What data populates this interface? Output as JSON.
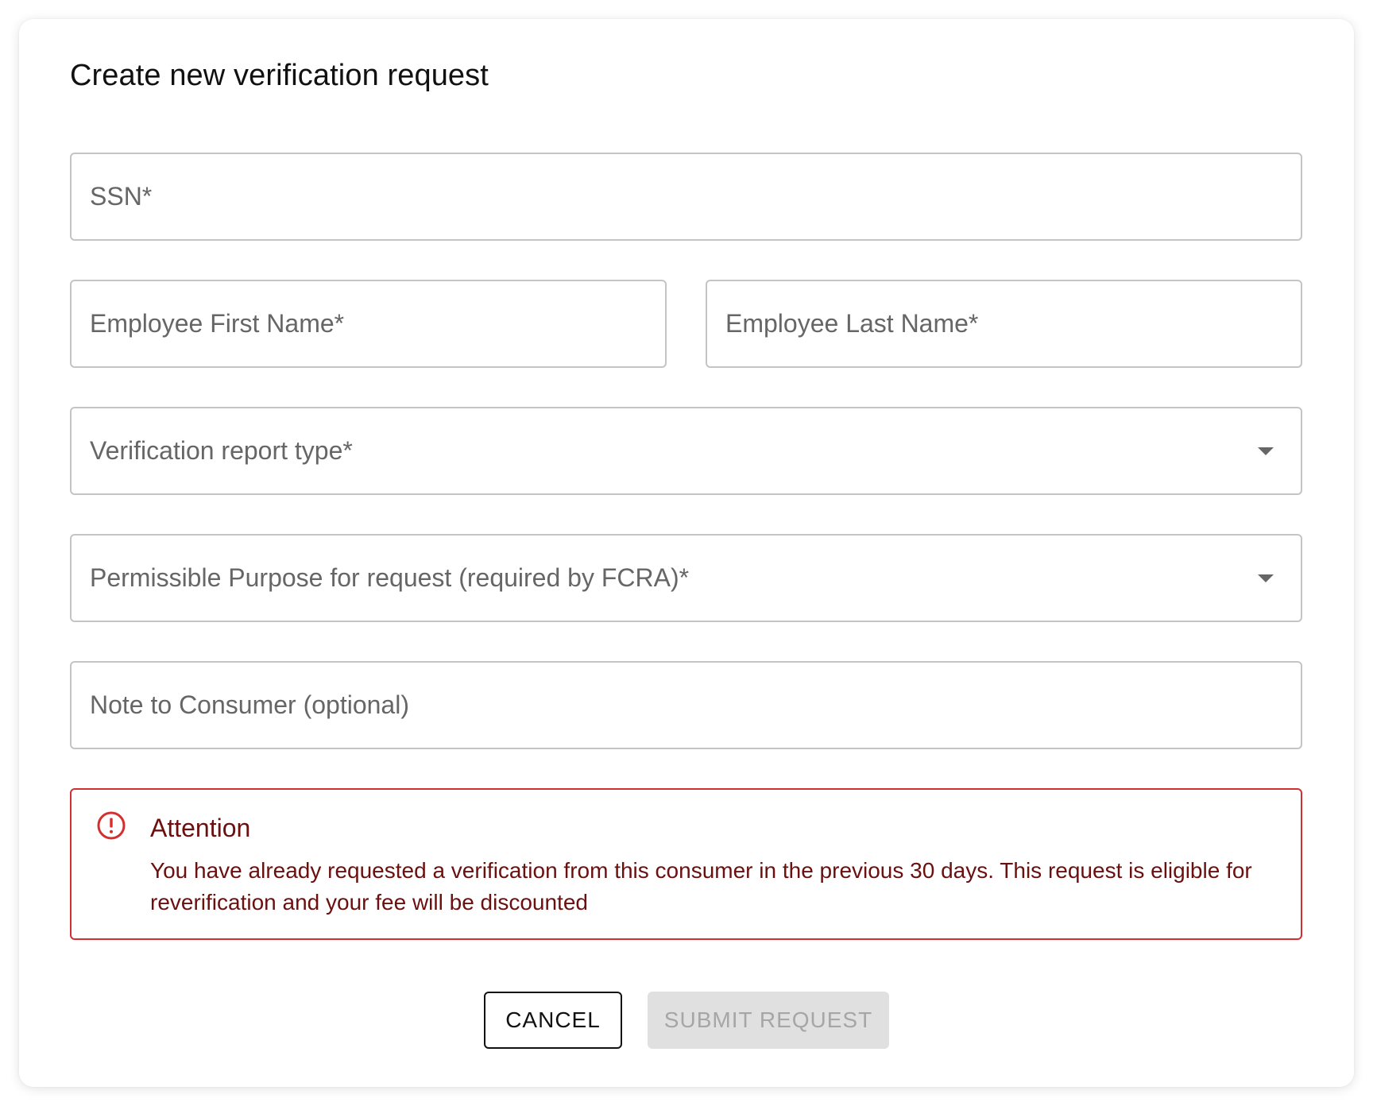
{
  "dialog": {
    "title": "Create new verification request"
  },
  "form": {
    "ssn_placeholder": "SSN*",
    "first_name_placeholder": "Employee First Name*",
    "last_name_placeholder": "Employee Last Name*",
    "report_type_label": "Verification report type*",
    "purpose_label": "Permissible Purpose for request (required by FCRA)*",
    "note_placeholder": "Note to Consumer (optional)"
  },
  "alert": {
    "icon": "error-circle-icon",
    "title": "Attention",
    "body": "You have already requested a verification from this consumer in the previous 30 days. This request is eligible for reverification and your fee will be discounted",
    "color": "#d32f2f",
    "text_color": "#6b0f0f"
  },
  "actions": {
    "cancel_label": "CANCEL",
    "submit_label": "SUBMIT REQUEST",
    "submit_disabled": true
  }
}
